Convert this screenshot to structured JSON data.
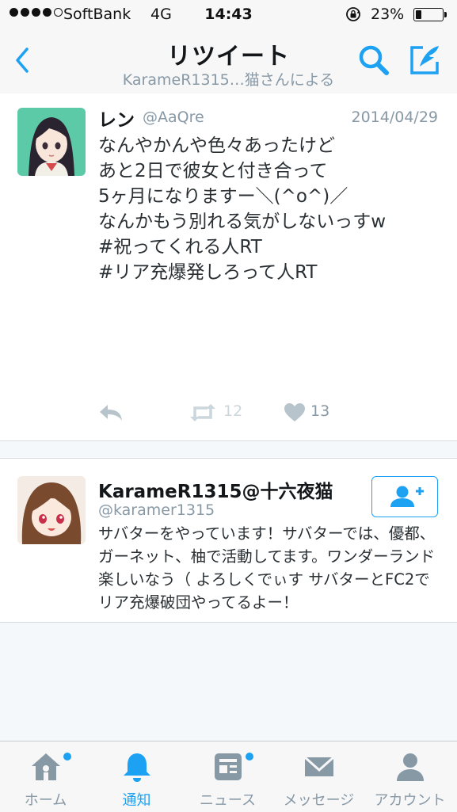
{
  "status_bar": {
    "carrier": "SoftBank",
    "network": "4G",
    "time": "14:43",
    "battery_text": "23%",
    "battery_level": 0.23
  },
  "nav": {
    "title": "リツイート",
    "subtitle": "KarameR1315…猫さんによる"
  },
  "tweet": {
    "name": "レン",
    "handle": "@AaQre",
    "date": "2014/04/29",
    "lines": [
      "なんやかんや色々あったけど",
      "",
      "あと2日で彼女と付き合って",
      "",
      "5ヶ月になりますー＼(^o^)／",
      "",
      "なんかもう別れる気がしないっすw",
      "",
      "#祝ってくれる人RT",
      "#リア充爆発しろって人RT"
    ],
    "retweet_count": "12",
    "like_count": "13"
  },
  "user": {
    "name": "KarameR1315@十六夜猫",
    "handle": "@karamer1315",
    "bio": "サバターをやっています！サバターでは、優都、ガーネット、柚で活動してます。ワンダーランド楽しいなう（ よろしくでぃす サバターとFC2でリア充爆破団やってるよー！"
  },
  "tabs": [
    {
      "label": "ホーム",
      "icon": "home-icon",
      "badge": true
    },
    {
      "label": "通知",
      "icon": "bell-icon",
      "badge": false,
      "active": true
    },
    {
      "label": "ニュース",
      "icon": "news-icon",
      "badge": true
    },
    {
      "label": "メッセージ",
      "icon": "envelope-icon",
      "badge": false
    },
    {
      "label": "アカウント",
      "icon": "person-icon",
      "badge": false
    }
  ],
  "colors": {
    "accent": "#1da1f2",
    "muted": "#8899a6",
    "text": "#292f33"
  }
}
